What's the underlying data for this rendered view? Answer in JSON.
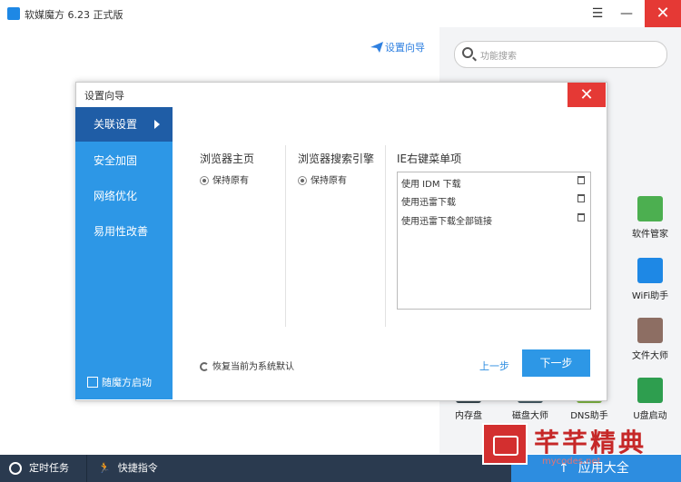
{
  "app": {
    "title": "软媒魔方 6.23 正式版"
  },
  "header": {
    "setup_wizard_link": "设置向导"
  },
  "search": {
    "placeholder": "功能搜索"
  },
  "tools": [
    {
      "label": "软件管家",
      "color": "#4caf50"
    },
    {
      "label": "WiFi助手",
      "color": "#1e88e5"
    },
    {
      "label": "文件大师",
      "color": "#8d6e63"
    },
    {
      "label": "U盘启动",
      "color": "#2e9e4f"
    },
    {
      "label": "内存盘",
      "color": "#37474f"
    },
    {
      "label": "磁盘大师",
      "color": "#455a64"
    },
    {
      "label": "DNS助手",
      "color": "#7cb342"
    }
  ],
  "bottom": {
    "timed_tasks": "定时任务",
    "quick_commands": "快捷指令",
    "app_store": "应用大全"
  },
  "watermark": {
    "text": "芊芊精典",
    "url": "mycodes.net"
  },
  "dialog": {
    "title": "设置向导",
    "nav": [
      "关联设置",
      "安全加固",
      "网络优化",
      "易用性改善"
    ],
    "startup_checkbox": "随魔方启动",
    "col1": {
      "title": "浏览器主页",
      "option": "保持原有"
    },
    "col2": {
      "title": "浏览器搜索引擎",
      "option": "保持原有"
    },
    "col3": {
      "title": "IE右键菜单项",
      "items": [
        "使用 IDM 下载",
        "使用迅雷下载",
        "使用迅雷下载全部链接"
      ]
    },
    "restore_default": "恢复当前为系统默认",
    "prev": "上一步",
    "next": "下一步"
  }
}
